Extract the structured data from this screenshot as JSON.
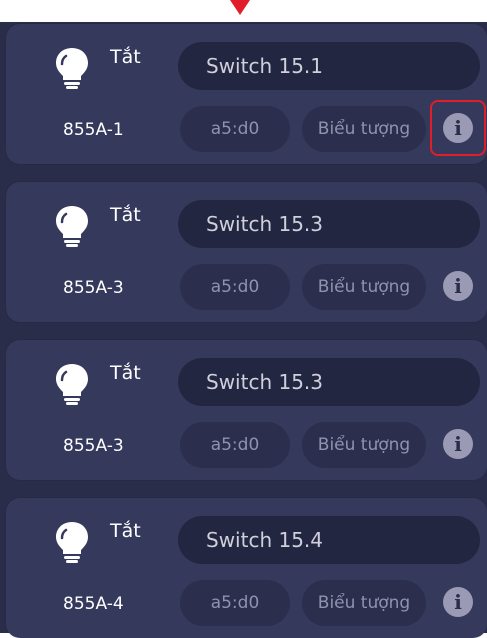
{
  "colors": {
    "panel_bg": "#2a2d4a",
    "card_bg": "#353a5d",
    "highlight": "#e11d2a",
    "info_button": "#9a9ab5"
  },
  "devices": [
    {
      "status": "Tắt",
      "name": "Switch 15.1",
      "code": "855A-1",
      "address": "a5:d0",
      "icon_label": "Biểu tượng",
      "info_icon": "info-icon"
    },
    {
      "status": "Tắt",
      "name": "Switch 15.3",
      "code": "855A-3",
      "address": "a5:d0",
      "icon_label": "Biểu tượng",
      "info_icon": "info-icon"
    },
    {
      "status": "Tắt",
      "name": "Switch 15.3",
      "code": "855A-3",
      "address": "a5:d0",
      "icon_label": "Biểu tượng",
      "info_icon": "info-icon"
    },
    {
      "status": "Tắt",
      "name": "Switch 15.4",
      "code": "855A-4",
      "address": "a5:d0",
      "icon_label": "Biểu tượng",
      "info_icon": "info-icon"
    }
  ]
}
